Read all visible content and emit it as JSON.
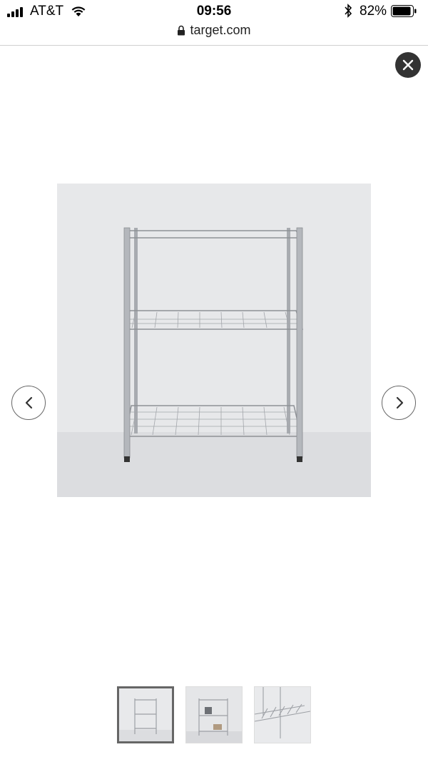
{
  "status_bar": {
    "carrier": "AT&T",
    "time": "09:56",
    "battery_percent": "82%"
  },
  "browser": {
    "url": "target.com"
  },
  "gallery": {
    "image_description": "3-tier chrome wire shelving unit",
    "thumbnails": [
      {
        "selected": true
      },
      {
        "selected": false
      },
      {
        "selected": false
      }
    ]
  },
  "icons": {
    "close": "close-icon",
    "prev": "chevron-left-icon",
    "next": "chevron-right-icon",
    "lock": "lock-icon",
    "wifi": "wifi-icon",
    "bluetooth": "bluetooth-icon",
    "battery": "battery-icon",
    "signal": "signal-icon"
  },
  "colors": {
    "close_bg": "#333333",
    "active_thumb_border": "#666666"
  }
}
